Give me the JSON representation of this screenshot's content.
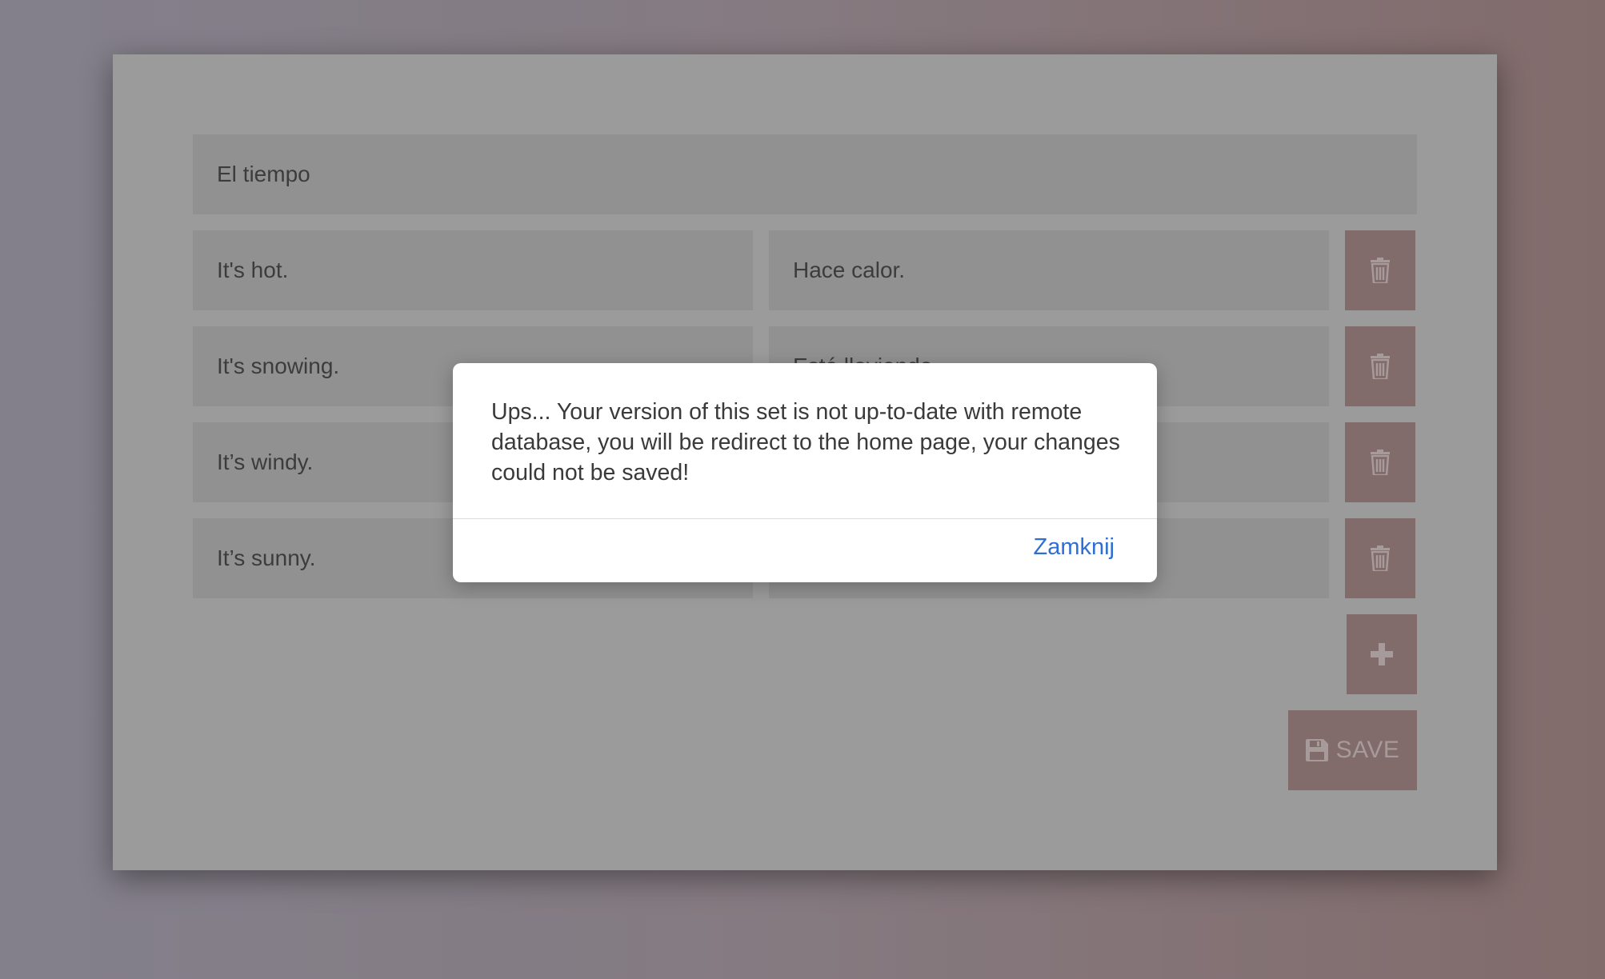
{
  "set": {
    "title": "El tiempo",
    "rows": [
      {
        "term": "It's hot.",
        "translation": "Hace calor."
      },
      {
        "term": "It's snowing.",
        "translation": "Está lloviendo."
      },
      {
        "term": "It’s windy.",
        "translation": ""
      },
      {
        "term": "It’s sunny.",
        "translation": ""
      }
    ]
  },
  "actions": {
    "delete_icon": "trash-icon",
    "add_icon": "plus-icon",
    "save_icon": "floppy-disk-icon",
    "save_label": "SAVE"
  },
  "dialog": {
    "message": "Ups... Your version of this set is not up-to-date with remote database, you will be redirect to the home page, your changes could not be saved!",
    "close_label": "Zamknij"
  },
  "colors": {
    "accent_button": "#816b6b",
    "link": "#2f6fd3",
    "overlay_card": "#9b9b9b"
  }
}
